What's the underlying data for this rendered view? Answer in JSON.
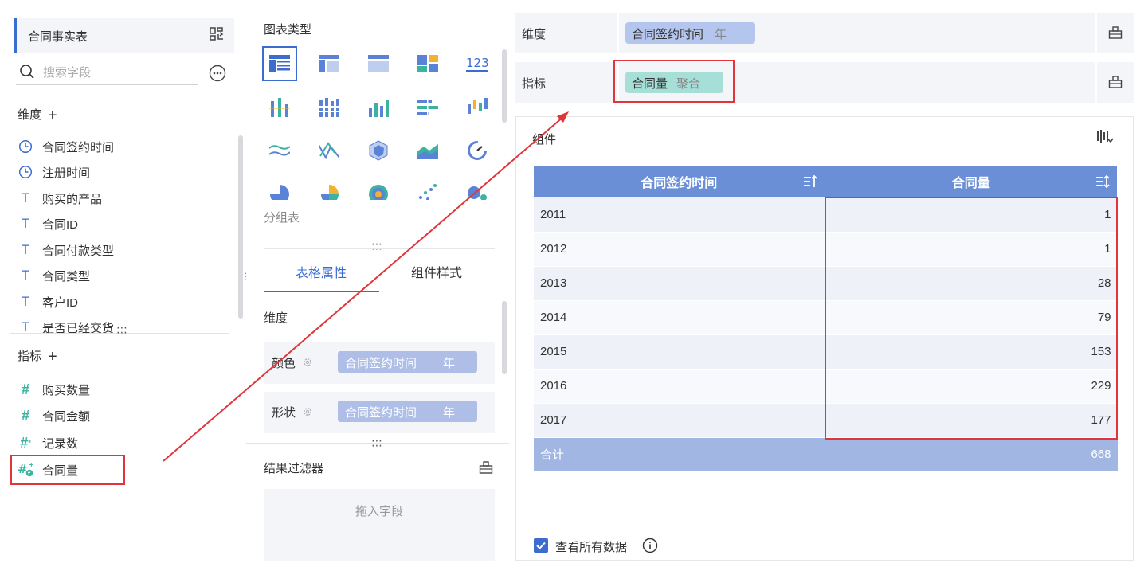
{
  "left": {
    "table_name": "合同事实表",
    "search_placeholder": "搜索字段",
    "dimensions_label": "维度",
    "dimensions": [
      {
        "label": "合同签约时间",
        "icon": "clock-icon"
      },
      {
        "label": "注册时间",
        "icon": "clock-icon"
      },
      {
        "label": "购买的产品",
        "icon": "text-type-icon"
      },
      {
        "label": "合同ID",
        "icon": "text-type-icon"
      },
      {
        "label": "合同付款类型",
        "icon": "text-type-icon"
      },
      {
        "label": "合同类型",
        "icon": "text-type-icon"
      },
      {
        "label": "客户ID",
        "icon": "text-type-icon"
      },
      {
        "label": "是否已经交货",
        "icon": "text-type-icon"
      }
    ],
    "measures_label": "指标",
    "measures": [
      {
        "label": "购买数量",
        "icon": "number-type-icon"
      },
      {
        "label": "合同金额",
        "icon": "number-type-icon"
      },
      {
        "label": "记录数",
        "icon": "record-count-icon"
      },
      {
        "label": "合同量",
        "icon": "calculated-number-icon"
      }
    ]
  },
  "middle": {
    "chart_types_title": "图表类型",
    "selected_chart_type": "分组表",
    "tabs": [
      {
        "label": "表格属性",
        "active": true
      },
      {
        "label": "组件样式",
        "active": false
      }
    ],
    "dimension_label": "维度",
    "color_row": {
      "label": "颜色",
      "field": "合同签约时间",
      "unit": "年"
    },
    "shape_row": {
      "label": "形状",
      "field": "合同签约时间",
      "unit": "年"
    },
    "result_filter_title": "结果过滤器",
    "drop_hint": "拖入字段"
  },
  "right": {
    "dimension_shelf": {
      "label": "维度",
      "chip": "合同签约时间",
      "chip_suffix": "年"
    },
    "measure_shelf": {
      "label": "指标",
      "chip": "合同量",
      "chip_suffix": "聚合"
    },
    "component_title": "组件",
    "table": {
      "headers": [
        "合同签约时间",
        "合同量"
      ],
      "rows": [
        {
          "year": "2011",
          "value": "1"
        },
        {
          "year": "2012",
          "value": "1"
        },
        {
          "year": "2013",
          "value": "28"
        },
        {
          "year": "2014",
          "value": "79"
        },
        {
          "year": "2015",
          "value": "153"
        },
        {
          "year": "2016",
          "value": "229"
        },
        {
          "year": "2017",
          "value": "177"
        }
      ],
      "total_label": "合计",
      "total_value": "668"
    },
    "view_all_label": "查看所有数据",
    "view_all_checked": true
  },
  "colors": {
    "accent": "#3c6cd0",
    "header": "#6b8fd6",
    "total_row": "#a1b6e3",
    "dimension_chip": "#b5c6ee",
    "measure_chip": "#a6dfd7",
    "annotation_red": "#e0353b"
  }
}
